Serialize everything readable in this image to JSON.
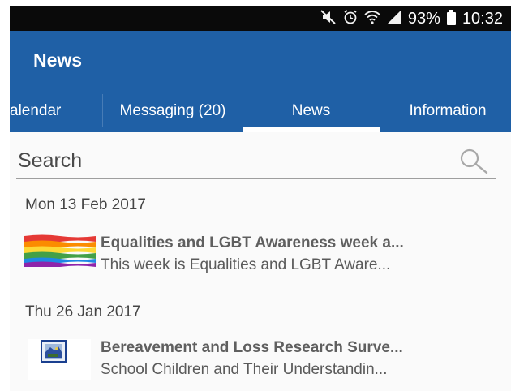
{
  "status_bar": {
    "icons": [
      "mute-icon",
      "alarm-icon",
      "wifi-icon",
      "signal-icon",
      "battery-icon"
    ],
    "battery": "93%",
    "time": "10:32"
  },
  "app_bar": {
    "title": "News",
    "background": "#1f60a6",
    "tabs": [
      {
        "label": "alendar"
      },
      {
        "label": "Messaging (20)"
      },
      {
        "label": "News",
        "selected": true
      },
      {
        "label": "Information"
      }
    ]
  },
  "search": {
    "placeholder": "Search",
    "value": ""
  },
  "news": [
    {
      "date": "Mon 13 Feb 2017",
      "title": "Equalities and LGBT Awareness week a...",
      "summary": "This week is Equalities and LGBT Aware...",
      "thumbnail": "rainbow-flag-image"
    },
    {
      "date": "Thu 26 Jan 2017",
      "title": "Bereavement and Loss Research Surve...",
      "summary": "School Children and Their Understandin...",
      "thumbnail": "school-crest-image"
    }
  ]
}
